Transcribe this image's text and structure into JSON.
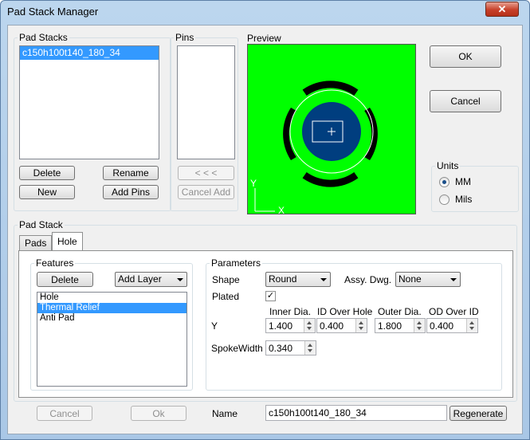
{
  "window": {
    "title": "Pad Stack Manager",
    "close_glyph": "✕"
  },
  "padstacks": {
    "label": "Pad Stacks",
    "items": [
      "c150h100t140_180_34"
    ],
    "delete": "Delete",
    "rename": "Rename",
    "new": "New",
    "add_pins": "Add Pins"
  },
  "pins": {
    "label": "Pins",
    "back": "< < <",
    "cancel_add": "Cancel Add"
  },
  "preview": {
    "label": "Preview",
    "axis_y": "Y",
    "axis_x": "X",
    "background_color": "#00ff00",
    "pad_color": "#003e7f"
  },
  "dialog": {
    "ok": "OK",
    "cancel": "Cancel"
  },
  "units": {
    "label": "Units",
    "options": [
      "MM",
      "Mils"
    ],
    "selected": "MM"
  },
  "padstack_group": {
    "label": "Pad Stack"
  },
  "tabs": {
    "pads": "Pads",
    "hole": "Hole",
    "active": "Hole"
  },
  "features": {
    "label": "Features",
    "delete": "Delete",
    "add_layer": "Add Layer",
    "items": [
      "Hole",
      "Thermal Relief",
      "Anti Pad"
    ],
    "selected": "Thermal Relief"
  },
  "parameters": {
    "label": "Parameters",
    "shape_label": "Shape",
    "shape_value": "Round",
    "assy_label": "Assy. Dwg.",
    "assy_value": "None",
    "plated_label": "Plated",
    "plated_checked": "✓",
    "headers": [
      "Inner Dia.",
      "ID Over Hole",
      "Outer Dia.",
      "OD Over ID"
    ],
    "row_label": "Y",
    "values": [
      "1.400",
      "0.400",
      "1.800",
      "0.400"
    ],
    "spoke_label": "SpokeWidth",
    "spoke_value": "0.340"
  },
  "footer": {
    "cancel": "Cancel",
    "ok": "Ok",
    "name_label": "Name",
    "name_value": "c150h100t140_180_34",
    "regenerate": "Regenerate"
  }
}
